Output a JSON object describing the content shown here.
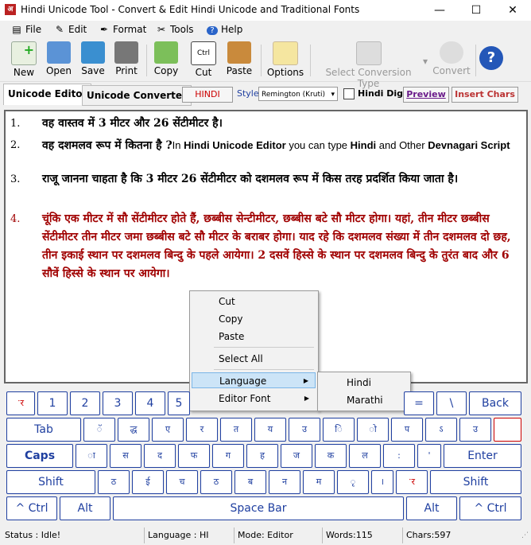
{
  "window": {
    "title": "Hindi Unicode Tool - Convert & Edit Hindi Unicode and Traditional Fonts"
  },
  "menu": [
    "File",
    "Edit",
    "Format",
    "Tools",
    "Help"
  ],
  "toolbar": {
    "new": "New",
    "open": "Open",
    "save": "Save",
    "print": "Print",
    "copy": "Copy",
    "cut": "Cut",
    "paste": "Paste",
    "options": "Options",
    "select_conversion": "Select Conversion Type",
    "convert": "Convert"
  },
  "tabs": {
    "editor": "Unicode Editor",
    "converter": "Unicode Converter"
  },
  "controls": {
    "hindi_btn": "HINDI",
    "style_label": "Style",
    "style_value": "Remington (Kruti)",
    "hindi_digit": "Hindi Digit",
    "preview": "Preview",
    "insert_chars": "Insert Chars"
  },
  "editor": {
    "l1_num": "1.",
    "l1_text": "वह वास्तव में 3 मीटर और 26 सेंटीमीटर है।",
    "l2_num": "2.",
    "l2_hi": "वह दशमलव रूप में कितना है ?",
    "l2_en1": "In ",
    "l2_enb1": "Hindi Unicode Editor",
    "l2_en2": " you can type ",
    "l2_enb2": "Hindi",
    "l2_en3": " and Other ",
    "l2_enb3": "Devnagari Script",
    "l3_num": "3.",
    "l3_text": "राजू जानना चाहता है कि 3 मीटर 26 सेंटीमीटर को दशमलव रूप में किस तरह प्रदर्शित किया जाता है।",
    "l4_num": "4.",
    "l4_text": "चूंकि एक मीटर में सौ सेंटीमीटर होते हैं, छब्बीस सेन्टीमीटर, छब्बीस बटे सौ मीटर होगा। यहां, तीन मीटर छब्बीस सेंटीमीटर तीन मीटर जमा छब्बीस बटे सौ मीटर के बराबर होगा। याद रहे कि दशमलव संख्या में तीन दशमलव दो छह, तीन इकाई स्थान पर दशमलव बिन्दु के पहले आयेगा। 2 दसवें हिस्से के स्थान पर दशमलव बिन्दु के तुरंत बाद और 6 सौवें हिस्से के स्थान पर आयेगा।"
  },
  "context_menu": {
    "cut": "Cut",
    "copy": "Copy",
    "paste": "Paste",
    "select_all": "Select All",
    "language": "Language",
    "editor_font": "Editor Font"
  },
  "submenu": {
    "hindi": "Hindi",
    "marathi": "Marathi"
  },
  "keyboard": {
    "row1": [
      "ॱर",
      "1",
      "2",
      "3",
      "4",
      "5",
      "=",
      "\\"
    ],
    "back": "Back",
    "tab": "Tab",
    "row2": [
      "ॅ",
      "द्ध",
      "ए",
      "र",
      "त",
      "य",
      "उ",
      "ि",
      "ो",
      "प",
      "ऽ",
      "उ"
    ],
    "caps": "Caps",
    "row3": [
      "ा",
      "स",
      "द",
      "फ",
      "ग",
      "ह",
      "ज",
      "क",
      "ल",
      ":",
      "'"
    ],
    "enter": "Enter",
    "shift_l": "Shift",
    "row4": [
      "ठ",
      "ई",
      "च",
      "ठ",
      "ब",
      "न",
      "म",
      "ृ",
      "।",
      "ॱर"
    ],
    "shift_r": "Shift",
    "ctrl_l": "^ Ctrl",
    "alt_l": "Alt",
    "space": "Space Bar",
    "alt_r": "Alt",
    "ctrl_r": "^ Ctrl"
  },
  "status": {
    "status": "Status :  Idle!",
    "language": "Language : HI",
    "mode": "Mode: Editor",
    "words": "Words:115",
    "chars": "Chars:597"
  },
  "colors": {
    "accent_red": "#a00000",
    "key_blue": "#1f3fa0"
  }
}
